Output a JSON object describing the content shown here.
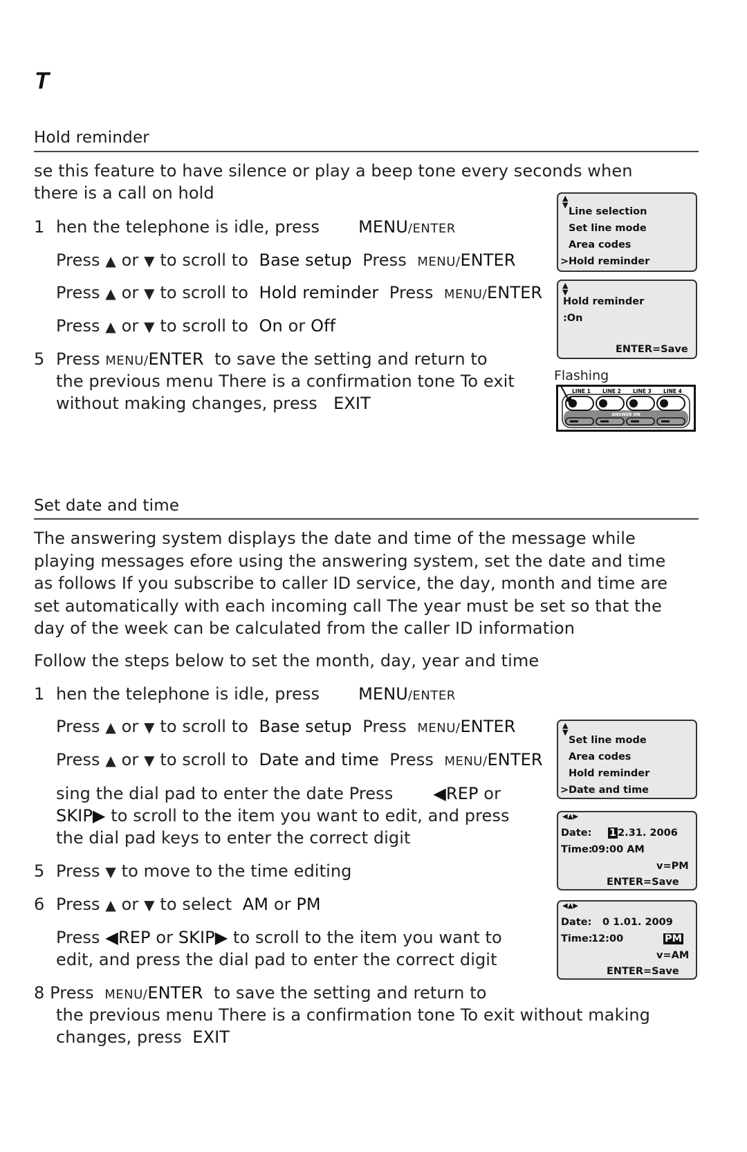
{
  "page_letter": "T",
  "hold": {
    "title": "Hold reminder",
    "intro_1": "se this feature to have silence or play a beep tone every  seconds when",
    "intro_2": "there is a call on hold",
    "step1": {
      "num": "1",
      "text": "hen the telephone is idle, press",
      "key_a": "MENU",
      "key_b": "/ENTER"
    },
    "step2": {
      "press": "Press",
      "up": "▲",
      "or": "or",
      "down": "▼",
      "scroll": "to scroll to",
      "target": "Base setup",
      "press2": "Press",
      "key_a": "MENU/",
      "key_b": "ENTER"
    },
    "step3": {
      "press": "Press",
      "up": "▲",
      "or": "or",
      "down": "▼",
      "scroll": "to scroll to",
      "target": "Hold reminder",
      "press2": "Press",
      "key_a": "MENU/",
      "key_b": "ENTER"
    },
    "step4": {
      "press": "Press",
      "up": "▲",
      "or": "or",
      "down": "▼",
      "scroll": "to scroll to",
      "opt1": "On",
      "or2": "or",
      "opt2": "Off"
    },
    "step5": {
      "num": "5",
      "press": "Press",
      "key_a": "MENU/",
      "key_b": "ENTER",
      "rest": "to save the setting and return to",
      "line2": "the previous menu There is a confirmation tone To exit",
      "line3": "without making changes, press",
      "exit": "EXIT"
    }
  },
  "lcd1": {
    "arrows": "▲▼",
    "items": [
      "Line selection",
      "Set line mode",
      "Area codes",
      "Hold reminder"
    ],
    "cursor": ">"
  },
  "lcd2": {
    "arrows": "▲▼",
    "title": "Hold reminder",
    "value": ":On",
    "footer": "ENTER=Save"
  },
  "phone_panel": {
    "flash_label": "Flashing",
    "lines": [
      "LINE 1",
      "LINE 2",
      "LINE 3",
      "LINE 4"
    ],
    "answer_label": "ANSWER ON"
  },
  "datetime": {
    "title": "Set date and time",
    "intro": [
      "The answering system displays the date and time of the message while",
      "playing messages efore using the answering system, set the date and time",
      "as follows If you subscribe to caller ID service, the day, month and time are",
      "set automatically with each incoming call The year must be set so that the",
      "day of the week can be calculated from the caller ID information"
    ],
    "follow": "Follow the steps below to set the month, day, year and time",
    "step1": {
      "num": "1",
      "text": "hen the telephone is idle, press",
      "key_a": "MENU",
      "key_b": "/ENTER"
    },
    "step2": {
      "press": "Press",
      "up": "▲",
      "or": "or",
      "down": "▼",
      "scroll": "to scroll to",
      "target": "Base setup",
      "press2": "Press",
      "key_a": "MENU/",
      "key_b": "ENTER"
    },
    "step3": {
      "press": "Press",
      "up": "▲",
      "or": "or",
      "down": "▼",
      "scroll": "to scroll to",
      "target": "Date and time",
      "press2": "Press",
      "key_a": "MENU/",
      "key_b": "ENTER"
    },
    "step4": {
      "line1": "sing the dial pad to enter the date Press",
      "rep": "◀REP",
      "or": "or",
      "skip": "SKIP▶",
      "line2": "to scroll to the item you want to edit, and press",
      "line3": "the dial pad keys to enter the correct digit"
    },
    "step5": {
      "num": "5",
      "press": "Press",
      "down": "▼",
      "text": "to move to the time editing"
    },
    "step6": {
      "num": "6",
      "press": "Press",
      "up": "▲",
      "or": "or",
      "down": "▼",
      "text": "to select",
      "am": "AM",
      "or2": "or",
      "pm": "PM"
    },
    "step7": {
      "press": "Press",
      "rep": "◀REP",
      "or": "or",
      "skip": "SKIP▶",
      "line1": "to scroll to the item you want to",
      "line2": "edit, and press the dial pad to enter the correct digit"
    },
    "step8": {
      "num": "8",
      "press": "Press",
      "key_a": "MENU/",
      "key_b": "ENTER",
      "rest": "to save the setting and return to",
      "line2": "the previous menu There is a confirmation tone To exit without making",
      "line3": "changes, press",
      "exit": "EXIT"
    }
  },
  "lcd3": {
    "arrows": "▲▼",
    "items": [
      "Set line mode",
      "Area codes",
      "Hold reminder",
      "Date and time"
    ],
    "cursor": ">"
  },
  "lcd4": {
    "arrows": "◀▲▼▶",
    "date_label": "Date:",
    "date_cursor": "1",
    "date_rest": "2.31. 2006",
    "time_label": "Time:",
    "time_value": "09:00  AM",
    "hint": "v=PM",
    "footer": "ENTER=Save"
  },
  "lcd5": {
    "arrows": "◀▲▼▶",
    "date_label": "Date:",
    "date_value": "0  1.01. 2009",
    "time_label": "Time:",
    "time_value": "12:00",
    "ampm": "PM",
    "hint": "v=AM",
    "footer": "ENTER=Save"
  }
}
